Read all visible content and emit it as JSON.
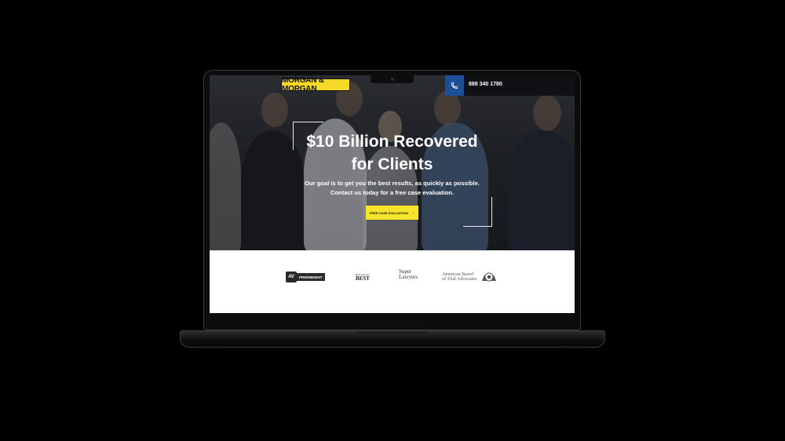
{
  "brand": {
    "logo_text": "MORGAN & MORGAN",
    "accent": "#f4d92b",
    "phone_box_color": "#1d4f99"
  },
  "header": {
    "phone_icon": "phone-icon",
    "phone_number": "888 340 1780"
  },
  "hero": {
    "headline_line1": "$10 Billion Recovered",
    "headline_line2": "for Clients",
    "subtext_line1": "Our goal is to get you the best results, as quickly as possible.",
    "subtext_line2": "Contact us today for a free case evaluation.",
    "cta_label": "FREE CASE EVALUATION",
    "cta_icon": "arrow-right-icon"
  },
  "awards": {
    "av_badge": "AV",
    "av_label": "PREEMINENT",
    "best_small": "Best Lawyers",
    "best_big": "BEST",
    "super_line1": "Super",
    "super_line2": "Lawyers",
    "abota_line1": "American Board",
    "abota_line2": "of Trial Advocates"
  }
}
